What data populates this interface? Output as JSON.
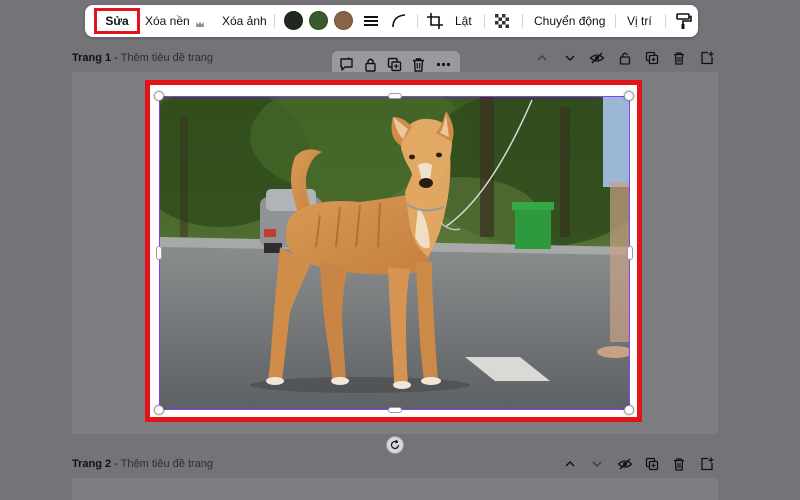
{
  "toolbar": {
    "edit_label": "Sửa",
    "remove_bg_label": "Xóa nền",
    "remove_image_label": "Xóa ảnh",
    "flip_label": "Lật",
    "animate_label": "Chuyển động",
    "position_label": "Vị trí",
    "colors": [
      "#1e2a1d",
      "#3b5a2c",
      "#8a6248"
    ]
  },
  "page1": {
    "title_prefix": "Trang 1",
    "separator": " - ",
    "title_placeholder": "Thêm tiêu đề trang"
  },
  "page2": {
    "title_prefix": "Trang 2",
    "separator": " - ",
    "title_placeholder": "Thêm tiêu đề trang"
  },
  "image": {
    "alt": "dog standing on road"
  },
  "colors": {
    "highlight": "#e3131b",
    "selection": "#8b3dff",
    "workspace": "#747478",
    "page": "#7e7e82"
  }
}
